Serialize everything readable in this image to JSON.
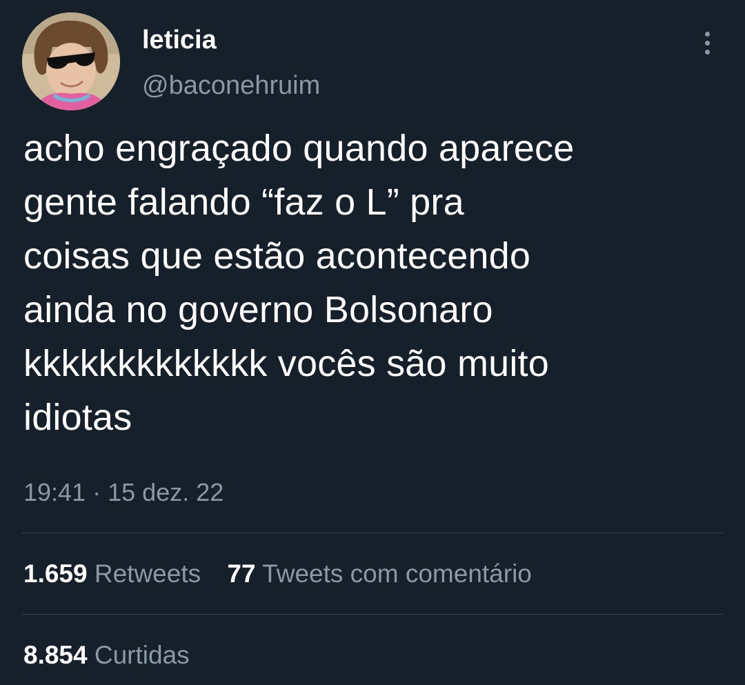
{
  "tweet": {
    "author": {
      "name": "leticia",
      "handle": "@baconehruim",
      "avatar_icon": "profile-photo"
    },
    "menu_icon": "more-vertical-icon",
    "text_lines": [
      "acho engraçado quando aparece",
      "gente falando “faz o L” pra",
      "coisas que estão acontecendo",
      "ainda no governo Bolsonaro",
      "kkkkkkkkkkkkk vocês são muito",
      "idiotas"
    ],
    "time": "19:41",
    "separator": "·",
    "date": "15 dez. 22",
    "stats": {
      "retweets_count": "1.659",
      "retweets_label": "Retweets",
      "quotes_count": "77",
      "quotes_label": "Tweets com comentário",
      "likes_count": "8.854",
      "likes_label": "Curtidas"
    }
  },
  "colors": {
    "background": "#15202b",
    "primary_text": "#ffffff",
    "secondary_text": "#8b98a5",
    "divider": "#38444d"
  }
}
